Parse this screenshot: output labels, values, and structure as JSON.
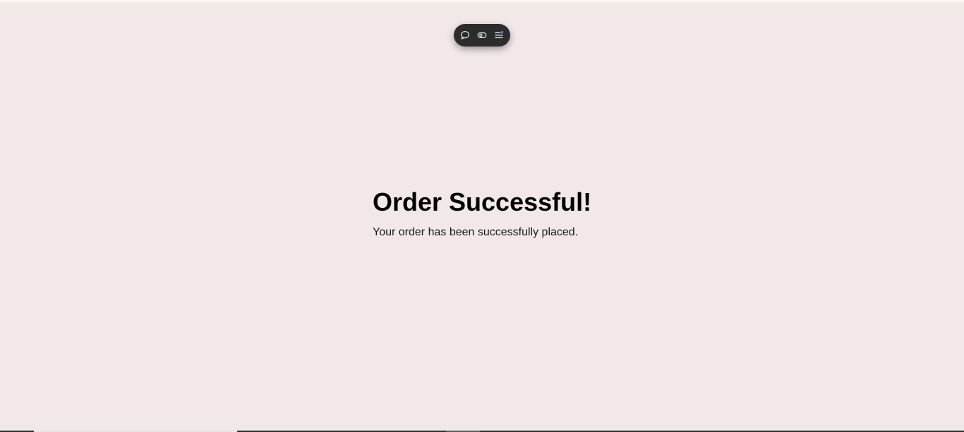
{
  "page": {
    "title": "Order Successful!",
    "message": "Your order has been successfully placed."
  },
  "toolbar": {
    "icons": [
      "comment-icon",
      "toggle-eye-icon",
      "menu-list-icon"
    ]
  },
  "colors": {
    "background": "#f2e8e8",
    "toolbar_bg": "#2c2c2c",
    "menu_dot_accent": "#4a90e2"
  }
}
